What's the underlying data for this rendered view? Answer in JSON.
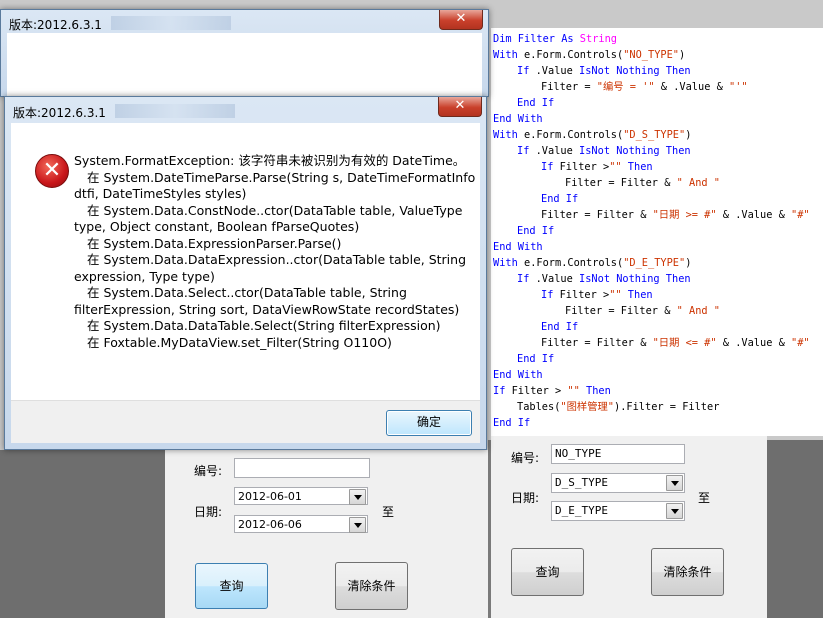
{
  "back_window": {
    "title": "版本:2012.6.3.1",
    "close_label": "✕"
  },
  "error_dialog": {
    "title": "版本:2012.6.3.1",
    "close_label": "✕",
    "icon_glyph": "✕",
    "message_lines": [
      "System.FormatException: 该字符串未被识别为有效的 DateTime。",
      "在 System.DateTimeParse.Parse(String s, DateTimeFormatInfo",
      "dtfi, DateTimeStyles styles)",
      "在 System.Data.ConstNode..ctor(DataTable table, ValueType",
      "type, Object constant, Boolean fParseQuotes)",
      "在 System.Data.ExpressionParser.Parse()",
      "在 System.Data.DataExpression..ctor(DataTable table, String",
      "expression, Type type)",
      "在 System.Data.Select..ctor(DataTable table, String",
      "filterExpression, String sort, DataViewRowState recordStates)",
      "在 System.Data.DataTable.Select(String filterExpression)",
      "在 Foxtable.MyDataView.set_Filter(String O110O)"
    ],
    "ok_label": "确定"
  },
  "code": {
    "line1": {
      "a": "Dim Filter As ",
      "b": "String"
    },
    "line2": {
      "a": "With",
      "b": " e.Form.Controls(",
      "c": "\"NO_TYPE\"",
      "d": ")"
    },
    "line3": {
      "a": "If",
      "b": " .Value ",
      "c": "IsNot Nothing Then"
    },
    "line4": {
      "a": "Filter = ",
      "b": "\"编号 = '\"",
      "c": " & .Value & ",
      "d": "\"'\""
    },
    "line5": "End If",
    "line6": "End With",
    "line7": {
      "a": "With",
      "b": " e.Form.Controls(",
      "c": "\"D_S_TYPE\"",
      "d": ")"
    },
    "line8": {
      "a": "If",
      "b": " .Value ",
      "c": "IsNot Nothing Then"
    },
    "line9": {
      "a": "If",
      "b": " Filter >",
      "c": "\"\"",
      "d": " Then"
    },
    "line10": {
      "a": "Filter = Filter & ",
      "b": "\" And \""
    },
    "line11": "End If",
    "line12": {
      "a": "Filter = Filter & ",
      "b": "\"日期 >= #\"",
      "c": " & .Value & ",
      "d": "\"#\""
    },
    "line13": "End If",
    "line14": "End With",
    "line15": {
      "a": "With",
      "b": " e.Form.Controls(",
      "c": "\"D_E_TYPE\"",
      "d": ")"
    },
    "line16": {
      "a": "If",
      "b": " .Value ",
      "c": "IsNot Nothing Then"
    },
    "line17": {
      "a": "If",
      "b": " Filter >",
      "c": "\"\"",
      "d": " Then"
    },
    "line18": {
      "a": "Filter = Filter & ",
      "b": "\" And \""
    },
    "line19": "End If",
    "line20": {
      "a": "Filter = Filter & ",
      "b": "\"日期 <= #\"",
      "c": " & .Value & ",
      "d": "\"#\""
    },
    "line21": "End If",
    "line22": "End With",
    "line23": {
      "a": "If",
      "b": " Filter > ",
      "c": "\"\"",
      "d": " Then"
    },
    "line24": {
      "a": "Tables(",
      "b": "\"图样管理\"",
      "c": ").Filter = Filter"
    },
    "line25": "End If"
  },
  "left_form": {
    "number_label": "编号:",
    "number_value": "",
    "date_label": "日期:",
    "to_label": "至",
    "start_date": "2012-06-01",
    "end_date": "2012-06-06",
    "query_label": "查询",
    "clear_label": "清除条件"
  },
  "right_form": {
    "number_label": "编号:",
    "number_value": "NO_TYPE",
    "date_label": "日期:",
    "to_label": "至",
    "start_value": "D_S_TYPE",
    "end_value": "D_E_TYPE",
    "query_label": "查询",
    "clear_label": "清除条件"
  }
}
